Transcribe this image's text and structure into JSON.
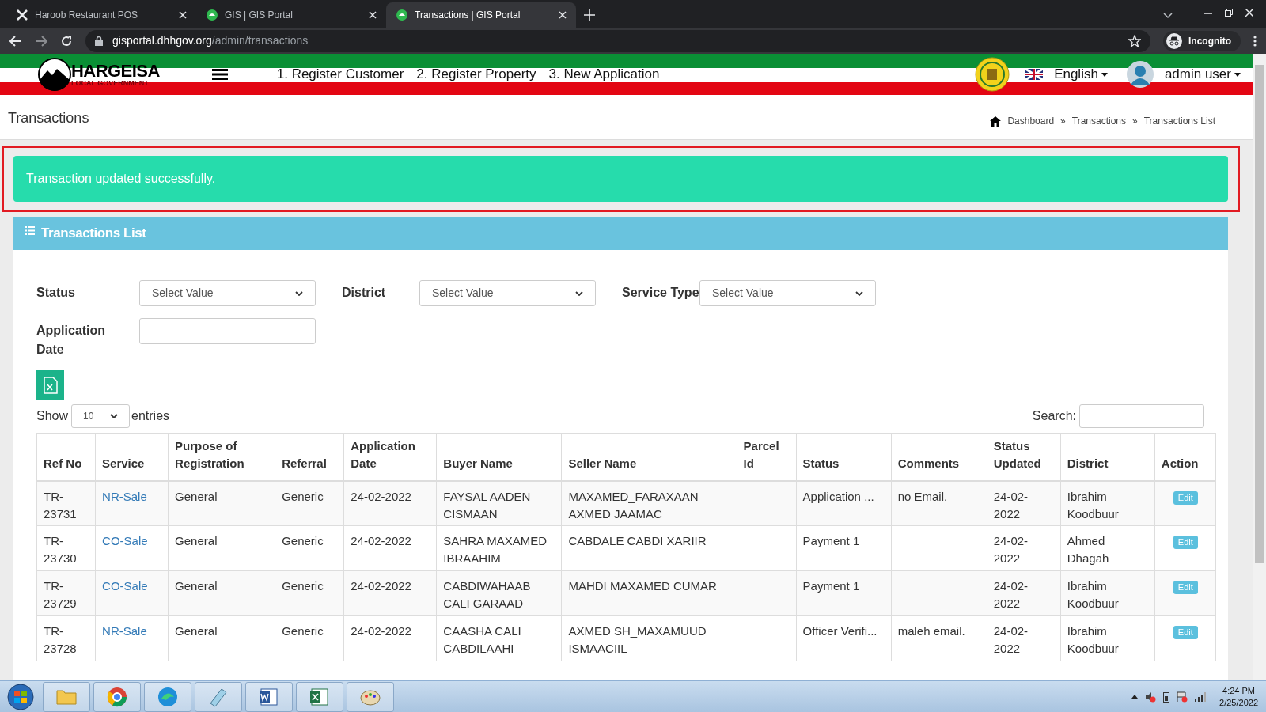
{
  "browser": {
    "tabs": [
      {
        "title": "Haroob Restaurant POS",
        "selected": false
      },
      {
        "title": "GIS | GIS Portal",
        "selected": false
      },
      {
        "title": "Transactions | GIS Portal",
        "selected": true
      }
    ],
    "url_host": "gisportal.dhhgov.org",
    "url_path": "/admin/transactions",
    "profile": "Incognito"
  },
  "header": {
    "logo_title": "HARGEISA",
    "logo_subtitle": "LOCAL GOVERNMENT",
    "nav": [
      "1. Register Customer",
      "2. Register Property",
      "3. New Application"
    ],
    "language": "English",
    "user": "admin user"
  },
  "page": {
    "title": "Transactions",
    "breadcrumbs": [
      "Dashboard",
      "Transactions",
      "Transactions List"
    ],
    "breadcrumb_separator": "»"
  },
  "alert": "Transaction updated successfully.",
  "panel": {
    "title": "Transactions List",
    "filters": [
      {
        "label": "Status",
        "kind": "select",
        "value": "Select Value"
      },
      {
        "label": "District",
        "kind": "select",
        "value": "Select Value"
      },
      {
        "label": "Service Type",
        "kind": "select",
        "value": "Select Value"
      },
      {
        "label": "Application Date",
        "kind": "input"
      }
    ],
    "show_label": "Show",
    "page_size": "10",
    "entries_label": "entries",
    "search_label": "Search:",
    "table": {
      "columns": [
        "Ref No",
        "Service",
        "Purpose of Registration",
        "Referral",
        "Application Date",
        "Buyer Name",
        "Seller Name",
        "Parcel Id",
        "Status",
        "Comments",
        "Status Updated",
        "District",
        "Action"
      ],
      "rows": [
        {
          "ref": "TR-23731",
          "service": "NR-Sale",
          "purpose": "General",
          "referral": "Generic",
          "date": "24-02-2022",
          "buyer": "FAYSAL AADEN CISMAAN",
          "seller": "MAXAMED_FARAXAAN AXMED JAAMAC",
          "status": "Application ...",
          "comments": "no Email.",
          "updated": "24-02-2022",
          "district": "Ibrahim Koodbuur",
          "action": "Edit"
        },
        {
          "ref": "TR-23730",
          "service": "CO-Sale",
          "purpose": "General",
          "referral": "Generic",
          "date": "24-02-2022",
          "buyer": "SAHRA MAXAMED IBRAAHIM",
          "seller": "CABDALE CABDI XARIIR",
          "status": "Payment 1",
          "updated": "24-02-2022",
          "district": "Ahmed Dhagah",
          "action": "Edit"
        },
        {
          "ref": "TR-23729",
          "service": "CO-Sale",
          "purpose": "General",
          "referral": "Generic",
          "date": "24-02-2022",
          "buyer": "CABDIWAHAAB CALI GARAAD",
          "seller": "MAHDI MAXAMED CUMAR",
          "status": "Payment 1",
          "updated": "24-02-2022",
          "district": "Ibrahim Koodbuur",
          "action": "Edit"
        },
        {
          "ref": "TR-23728",
          "service": "NR-Sale",
          "purpose": "General",
          "referral": "Generic",
          "date": "24-02-2022",
          "buyer": "CAASHA CALI CABDILAAHI",
          "seller": "AXMED SH_MAXAMUUD ISMAACIIL",
          "status": "Officer Verifi...",
          "comments": "maleh email.",
          "updated": "24-02-2022",
          "district": "Ibrahim Koodbuur",
          "action": "Edit"
        }
      ]
    }
  },
  "taskbar": {
    "time": "4:24 PM",
    "date": "2/25/2022"
  }
}
